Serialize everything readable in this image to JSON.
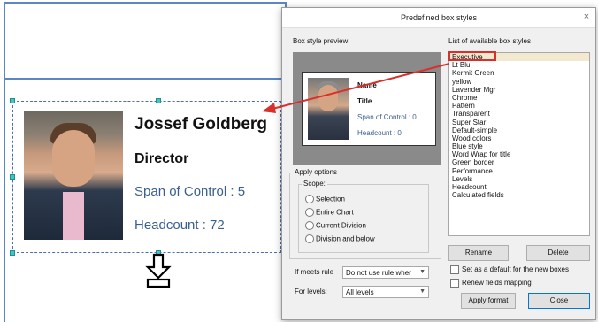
{
  "chart_box": {
    "name": "Jossef Goldberg",
    "title": "Director",
    "span_of_control": "Span of Control : 5",
    "headcount": "Headcount : 72"
  },
  "dialog": {
    "title": "Predefined box styles",
    "close_glyph": "×",
    "preview_label": "Box style preview",
    "list_label": "List of available box styles",
    "preview_card": {
      "name": "Name",
      "title": "Title",
      "span": "Span of Control : 0",
      "headcount": "Headcount : 0"
    },
    "apply_options_label": "Apply options",
    "scope_label": "Scope:",
    "scope_options": [
      "Selection",
      "Entire Chart",
      "Current Division",
      "Division and below"
    ],
    "if_meets_rule_label": "If meets rule",
    "if_meets_rule_value": "Do not use rule wher",
    "for_levels_label": "For levels:",
    "for_levels_value": "All levels",
    "styles": [
      "Executive",
      "Lt Blu",
      "Kermit Green",
      "yellow",
      "Lavender Mgr",
      "Chrome",
      "Pattern",
      "Transparent",
      "Super Star!",
      "Default-simple",
      "Wood colors",
      "Blue style",
      "Word Wrap for title",
      "Green border",
      "Performance",
      "Levels",
      "Headcount",
      "Calculated fields"
    ],
    "selected_style": "Executive",
    "rename_label": "Rename",
    "delete_label": "Delete",
    "set_default_label": "Set as a default for the new boxes",
    "renew_fields_label": "Renew fields mapping",
    "apply_label": "Apply format",
    "close_label": "Close"
  },
  "colors": {
    "accent_blue": "#5b87c7",
    "highlight_red": "#d9302c",
    "selection_bg": "#f3e9d0",
    "metric_text": "#3a5f8f"
  }
}
